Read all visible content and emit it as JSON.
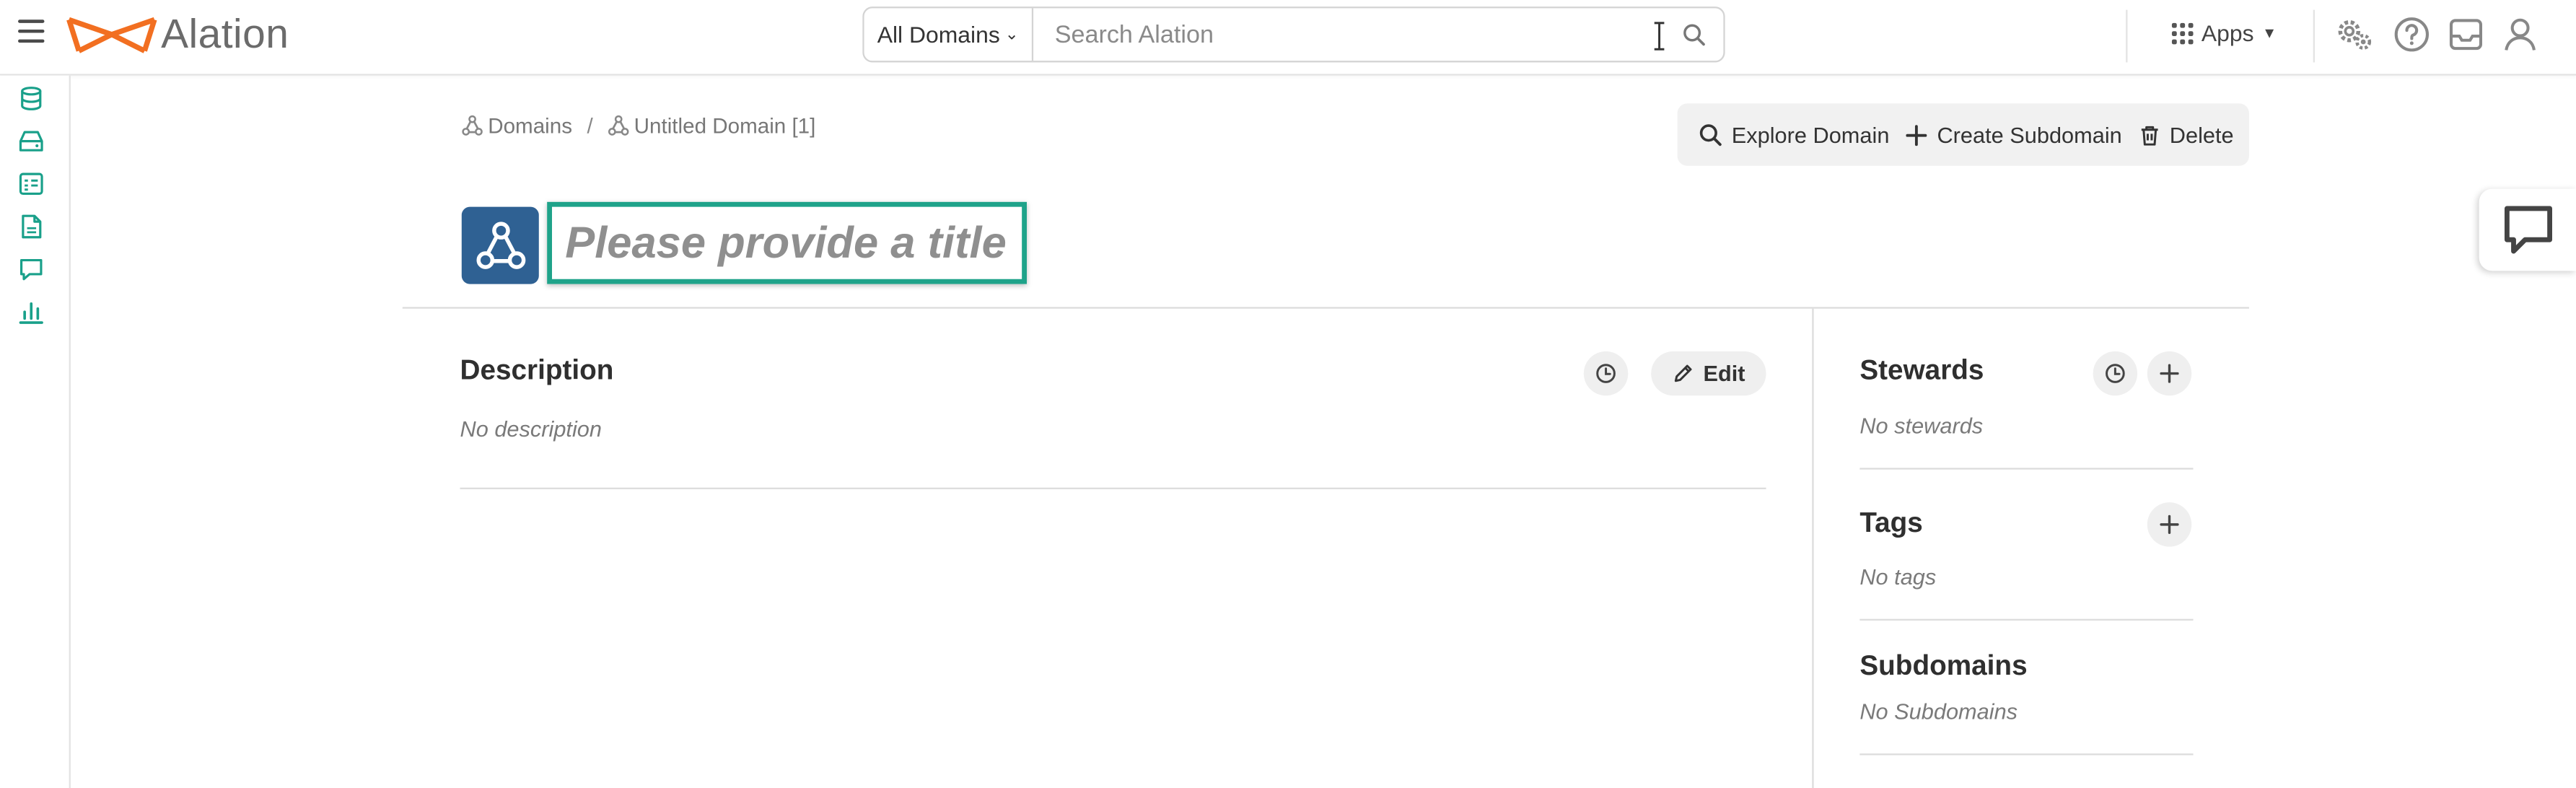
{
  "header": {
    "logo_text": "Alation",
    "search": {
      "domain_filter": "All Domains",
      "placeholder": "Search Alation",
      "value": ""
    },
    "apps_label": "Apps",
    "icons": [
      "settings-gears-icon",
      "help-icon",
      "inbox-icon",
      "user-icon"
    ]
  },
  "sidebar": {
    "icons": [
      "database-icon",
      "storage-icon",
      "catalog-list-icon",
      "document-icon",
      "conversation-icon",
      "analytics-icon"
    ]
  },
  "breadcrumb": [
    {
      "label": "Domains"
    },
    {
      "label": "Untitled Domain [1]"
    }
  ],
  "breadcrumb_separator": "/",
  "actions": {
    "explore": "Explore Domain",
    "create_subdomain": "Create Subdomain",
    "delete": "Delete"
  },
  "title": {
    "placeholder": "Please provide a title",
    "value": ""
  },
  "description": {
    "heading": "Description",
    "empty": "No description",
    "edit_label": "Edit"
  },
  "right_panel": {
    "stewards": {
      "heading": "Stewards",
      "empty": "No stewards"
    },
    "tags": {
      "heading": "Tags",
      "empty": "No tags"
    },
    "subdomains": {
      "heading": "Subdomains",
      "empty": "No Subdomains"
    }
  },
  "colors": {
    "brand_orange": "#f26f21",
    "accent_teal": "#1fa38a",
    "domain_icon_bg": "#2f6193",
    "rail_icon": "#19a08a"
  }
}
